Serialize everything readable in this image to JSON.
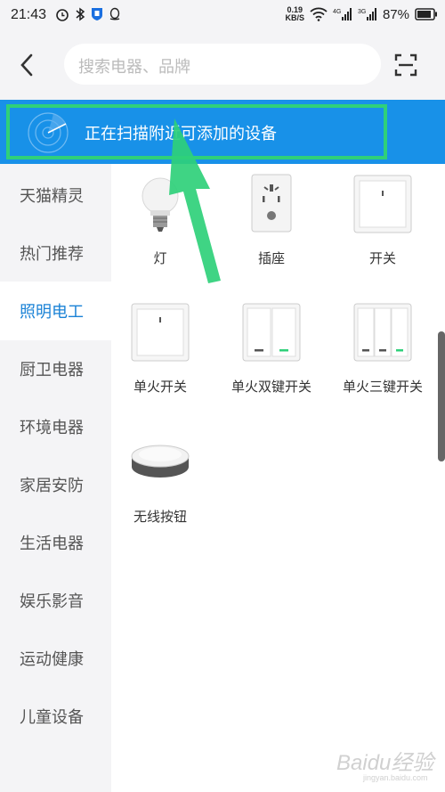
{
  "status": {
    "time": "21:43",
    "netspeed_value": "0.19",
    "netspeed_unit": "KB/S",
    "battery": "87%"
  },
  "search": {
    "placeholder": "搜索电器、品牌"
  },
  "banner": {
    "text": "正在扫描附近可添加的设备"
  },
  "sidebar": {
    "items": [
      {
        "label": "天猫精灵"
      },
      {
        "label": "热门推荐"
      },
      {
        "label": "照明电工",
        "active": true
      },
      {
        "label": "厨卫电器"
      },
      {
        "label": "环境电器"
      },
      {
        "label": "家居安防"
      },
      {
        "label": "生活电器"
      },
      {
        "label": "娱乐影音"
      },
      {
        "label": "运动健康"
      },
      {
        "label": "儿童设备"
      }
    ]
  },
  "devices": [
    {
      "label": "灯",
      "icon": "bulb-icon"
    },
    {
      "label": "插座",
      "icon": "socket-icon"
    },
    {
      "label": "开关",
      "icon": "switch-icon"
    },
    {
      "label": "单火开关",
      "icon": "single-switch-icon"
    },
    {
      "label": "单火双键开关",
      "icon": "double-switch-icon"
    },
    {
      "label": "单火三键开关",
      "icon": "triple-switch-icon"
    },
    {
      "label": "无线按钮",
      "icon": "wireless-button-icon"
    }
  ],
  "watermark": {
    "text": "Baidu经验",
    "sub": "jingyan.baidu.com"
  },
  "colors": {
    "accent": "#1a82d6",
    "banner": "#1891e8",
    "highlight": "#2fd07a"
  }
}
